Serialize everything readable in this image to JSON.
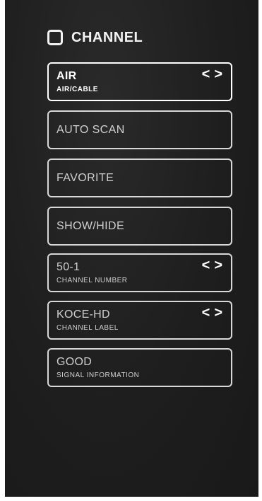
{
  "header": {
    "title": "CHANNEL",
    "icon": "tv-icon"
  },
  "items": [
    {
      "id": "air-cable",
      "primary": "AIR",
      "secondary": "AIR/CABLE",
      "selected": true,
      "has_arrows": true
    },
    {
      "id": "auto-scan",
      "label": "AUTO SCAN"
    },
    {
      "id": "favorite",
      "label": "FAVORITE"
    },
    {
      "id": "show-hide",
      "label": "SHOW/HIDE"
    },
    {
      "id": "channel-number",
      "primary": "50-1",
      "secondary": "CHANNEL NUMBER",
      "has_arrows": true
    },
    {
      "id": "channel-label",
      "primary": "KOCE-HD",
      "secondary": "CHANNEL LABEL",
      "has_arrows": true
    },
    {
      "id": "signal-information",
      "primary": "GOOD",
      "secondary": "SIGNAL INFORMATION"
    }
  ],
  "arrows": {
    "left": "<",
    "right": ">"
  },
  "colors": {
    "background": "#1e1e1e",
    "border": "#d8d8d8",
    "text": "#cfcfcf",
    "selected": "#ffffff"
  }
}
